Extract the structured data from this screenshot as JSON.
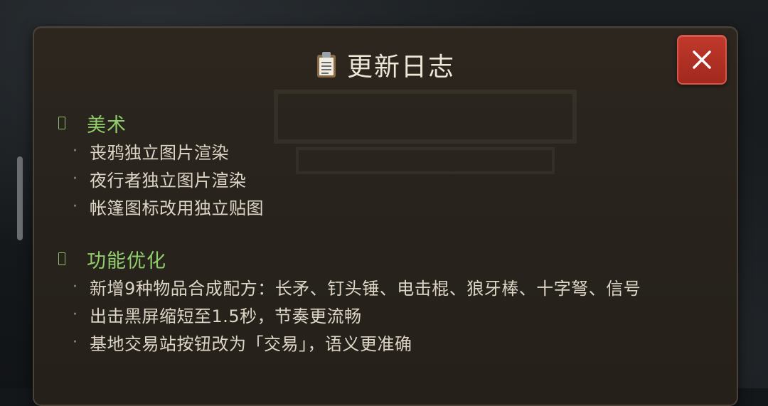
{
  "dialog": {
    "title": "更新日志",
    "title_icon": "clipboard-icon",
    "close_icon": "close-icon"
  },
  "sections": [
    {
      "title": "美术",
      "items": [
        "丧鸦独立图片渲染",
        "夜行者独立图片渲染",
        "帐篷图标改用独立贴图"
      ]
    },
    {
      "title": "功能优化",
      "items": [
        "新增9种物品合成配方：长矛、钉头锤、电击棍、狼牙棒、十字弩、信号",
        "出击黑屏缩短至1.5秒，节奏更流畅",
        "基地交易站按钮改为「交易」，语义更准确"
      ]
    }
  ],
  "bullet": "·",
  "colors": {
    "panel_bg": "#2a241d",
    "title_text": "#efe7d6",
    "section_title": "#8fce6b",
    "item_text": "#ddd5c5",
    "close_button": "#b23226"
  }
}
